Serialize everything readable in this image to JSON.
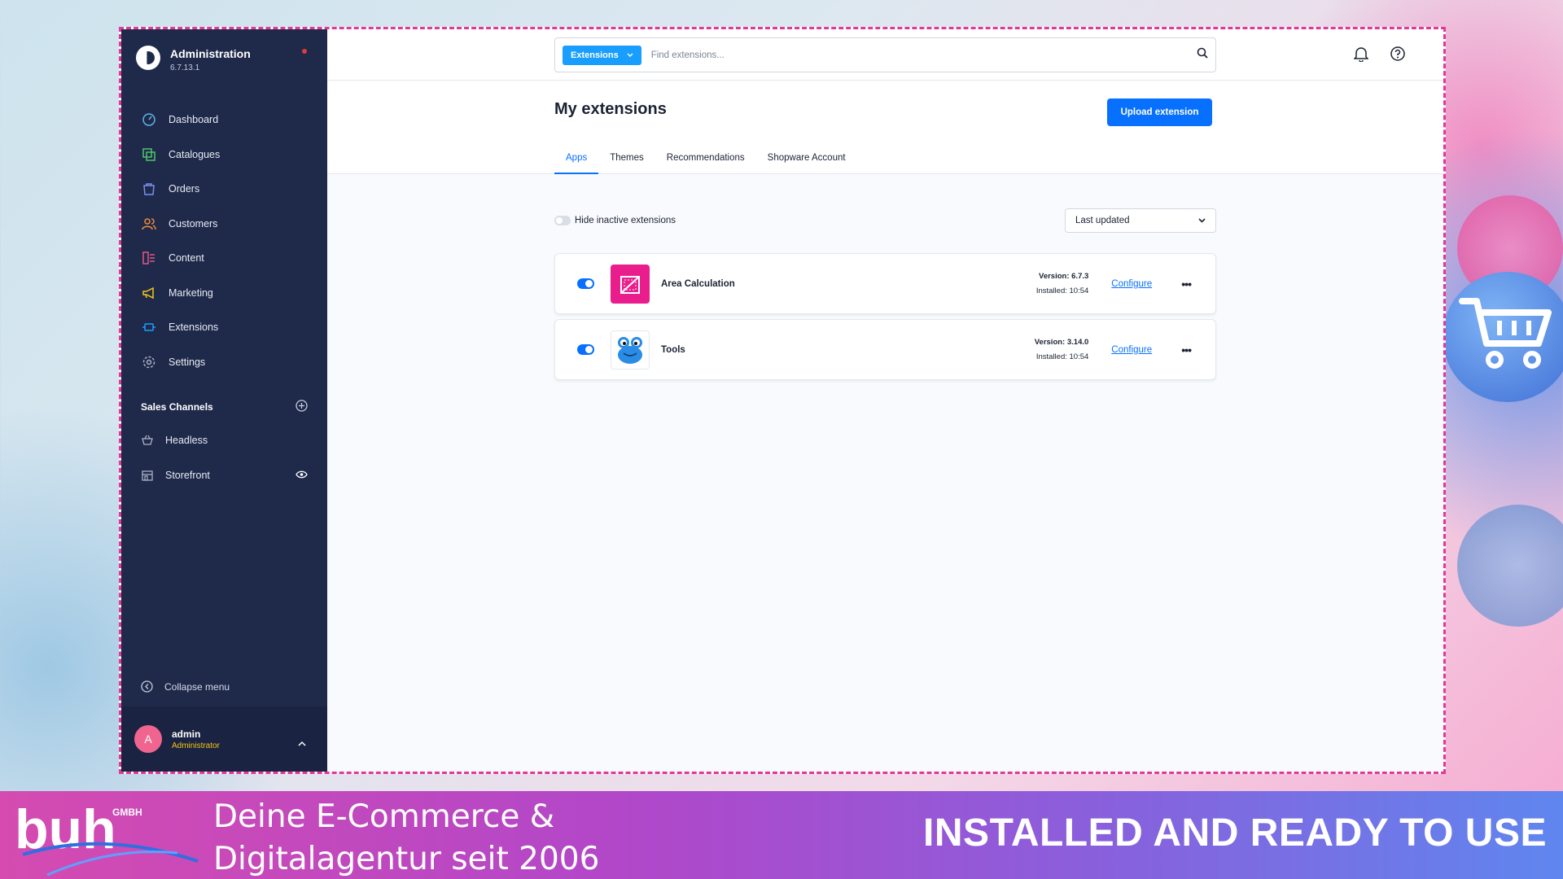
{
  "app": {
    "title": "Administration",
    "version": "6.7.13.1"
  },
  "sidebar": {
    "items": [
      {
        "label": "Dashboard",
        "icon": "dashboard-icon",
        "color": "#5fb3e4"
      },
      {
        "label": "Catalogues",
        "icon": "catalogue-icon",
        "color": "#4fc36b"
      },
      {
        "label": "Orders",
        "icon": "orders-icon",
        "color": "#7a8cf0"
      },
      {
        "label": "Customers",
        "icon": "customers-icon",
        "color": "#f08a3c"
      },
      {
        "label": "Content",
        "icon": "content-icon",
        "color": "#e0568b"
      },
      {
        "label": "Marketing",
        "icon": "marketing-icon",
        "color": "#f5c518"
      },
      {
        "label": "Extensions",
        "icon": "extensions-icon",
        "color": "#189eff"
      },
      {
        "label": "Settings",
        "icon": "settings-icon",
        "color": "#aab3c8"
      }
    ],
    "sales_channels_title": "Sales Channels",
    "sales_channels": [
      {
        "label": "Headless",
        "icon": "basket-icon"
      },
      {
        "label": "Storefront",
        "icon": "storefront-icon"
      }
    ],
    "collapse_label": "Collapse menu",
    "user": {
      "initial": "A",
      "name": "admin",
      "role": "Administrator"
    }
  },
  "search": {
    "type_label": "Extensions",
    "placeholder": "Find extensions..."
  },
  "page": {
    "title": "My extensions",
    "upload_label": "Upload extension",
    "tabs": [
      "Apps",
      "Themes",
      "Recommendations",
      "Shopware Account"
    ],
    "active_tab": "Apps",
    "hide_inactive_label": "Hide inactive extensions",
    "sort_value": "Last updated"
  },
  "extensions": [
    {
      "name": "Area Calculation",
      "version": "Version: 6.7.3",
      "installed": "Installed: 10:54",
      "configure": "Configure",
      "active": true
    },
    {
      "name": "Tools",
      "version": "Version: 3.14.0",
      "installed": "Installed: 10:54",
      "configure": "Configure",
      "active": true
    }
  ],
  "banner": {
    "logo_text": "buhl GMBH",
    "tagline_line1": "Deine E-Commerce &",
    "tagline_line2": "Digitalagentur seit 2006",
    "cta": "INSTALLED AND READY TO USE"
  },
  "colors": {
    "accent": "#0870ff",
    "sidebar": "#1f2a4a",
    "frame": "#e0399a"
  }
}
